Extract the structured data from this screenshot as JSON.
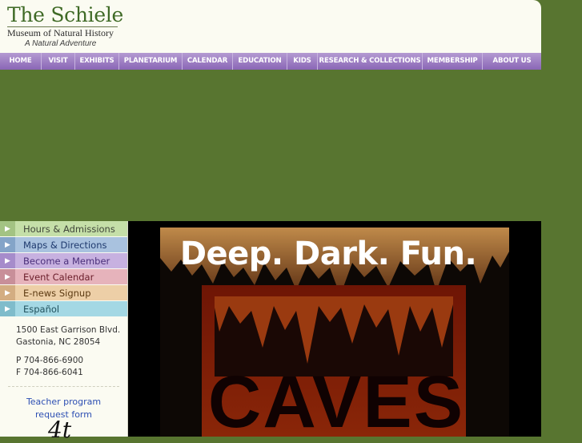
{
  "brand": {
    "title": "The Schiele",
    "subtitle": "Museum of Natural History",
    "tagline": "A Natural Adventure"
  },
  "nav": [
    {
      "label": "HOME"
    },
    {
      "label": "VISIT"
    },
    {
      "label": "EXHIBITS"
    },
    {
      "label": "PLANETARIUM"
    },
    {
      "label": "CALENDAR"
    },
    {
      "label": "EDUCATION"
    },
    {
      "label": "KIDS"
    },
    {
      "label": "RESEARCH & COLLECTIONS"
    },
    {
      "label": "MEMBERSHIP"
    },
    {
      "label": "ABOUT US"
    }
  ],
  "sidebar": {
    "links": [
      {
        "label": "Hours & Admissions",
        "color": "#c5dfa8",
        "arrow": "#a3c383",
        "text": "#40463a"
      },
      {
        "label": "Maps & Directions",
        "color": "#a9c2df",
        "arrow": "#84a4c8",
        "text": "#1f3a6e"
      },
      {
        "label": "Become a Member",
        "color": "#c7b1e0",
        "arrow": "#a68ccb",
        "text": "#4a2f7a"
      },
      {
        "label": "Event Calendar",
        "color": "#e6b3bb",
        "arrow": "#c88f99",
        "text": "#6a1d2a"
      },
      {
        "label": "E-news Signup",
        "color": "#edcfa7",
        "arrow": "#d3ad82",
        "text": "#5c3a12"
      },
      {
        "label": "Español",
        "color": "#a4d8e4",
        "arrow": "#7fbccb",
        "text": "#21525e"
      }
    ],
    "address_line1": "1500 East Garrison Blvd.",
    "address_line2": "Gastonia, NC 28054",
    "phone": "P 704-866-6900",
    "fax": "F 704-866-6041",
    "teacher_line1": "Teacher program",
    "teacher_line2": "request form",
    "badge_partial": "4t"
  },
  "banner": {
    "headline": "Deep. Dark. Fun.",
    "exhibit": "CAVES"
  }
}
